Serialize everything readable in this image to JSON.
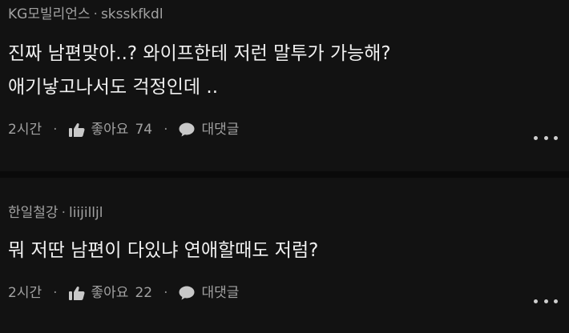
{
  "comments": [
    {
      "author": "KG모빌리언스",
      "user_id": "sksskfkdl",
      "lines": [
        "진짜 남편맞아..? 와이프한테 저런 말투가 가능해?",
        "애기낳고나서도 걱정인데 .."
      ],
      "time": "2시간",
      "like_label": "좋아요",
      "like_count": "74",
      "reply_label": "대댓글"
    },
    {
      "author": "한일철강",
      "user_id": "liijilljl",
      "lines": [
        "뭐 저딴 남편이 다있냐 연애할때도 저럼?"
      ],
      "time": "2시간",
      "like_label": "좋아요",
      "like_count": "22",
      "reply_label": "대댓글"
    }
  ],
  "meta_separator": "·",
  "icons": {
    "like": "thumbs-up-icon",
    "reply": "speech-bubble-icon",
    "more": "more-dots-icon"
  },
  "colors": {
    "background": "#121212",
    "text": "#f0f0f0",
    "muted": "#a2a2a2"
  }
}
